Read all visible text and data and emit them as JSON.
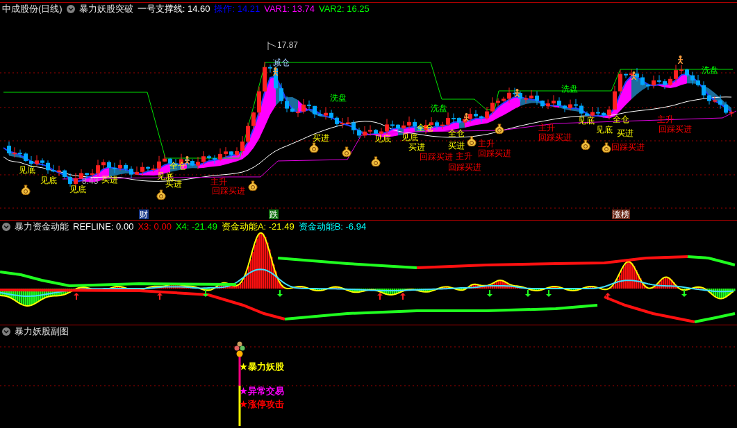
{
  "header": {
    "title": "中成股份(日线)",
    "indicator": "暴力妖股突破",
    "values": [
      {
        "text": "一号支撑线: 14.60",
        "color": "#ffffff"
      },
      {
        "text": "操作: 14.21",
        "color": "#0000ff"
      },
      {
        "text": "VAR1: 13.74",
        "color": "#ff00ff"
      },
      {
        "text": "VAR2: 16.25",
        "color": "#00ff00"
      }
    ]
  },
  "main_chart": {
    "price_labels": [
      {
        "kind": "high",
        "text": "17.87"
      },
      {
        "kind": "low",
        "text": "8.43"
      }
    ],
    "signals": [
      {
        "kind": "bottom",
        "text": "见底"
      },
      {
        "kind": "bottom",
        "text": "见底"
      },
      {
        "kind": "bottom",
        "text": "见底"
      },
      {
        "kind": "buy",
        "text": "买进"
      },
      {
        "kind": "bottom",
        "text": "见底"
      },
      {
        "kind": "full",
        "text": "全仓"
      },
      {
        "kind": "buy",
        "text": "买进"
      },
      {
        "kind": "surge",
        "text": "主升"
      },
      {
        "kind": "pullback",
        "text": "回踩买进"
      },
      {
        "kind": "reduce",
        "text": "减仓"
      },
      {
        "kind": "buy",
        "text": "买进"
      },
      {
        "kind": "wash",
        "text": "洗盘"
      },
      {
        "kind": "bottom",
        "text": "见底"
      },
      {
        "kind": "bottom",
        "text": "见底"
      },
      {
        "kind": "full",
        "text": "全仓"
      },
      {
        "kind": "buy",
        "text": "买进"
      },
      {
        "kind": "wash",
        "text": "洗盘"
      },
      {
        "kind": "pullback",
        "text": "回踩买进"
      },
      {
        "kind": "full",
        "text": "全仓"
      },
      {
        "kind": "buy",
        "text": "买进"
      },
      {
        "kind": "surge",
        "text": "主升"
      },
      {
        "kind": "pullback",
        "text": "回踩买进"
      },
      {
        "kind": "surge",
        "text": "主升"
      },
      {
        "kind": "pullback",
        "text": "回踩买进"
      },
      {
        "kind": "surge",
        "text": "主升"
      },
      {
        "kind": "pullback",
        "text": "回踩买进"
      },
      {
        "kind": "wash",
        "text": "洗盘"
      },
      {
        "kind": "bottom",
        "text": "见底"
      },
      {
        "kind": "bottom",
        "text": "见底"
      },
      {
        "kind": "full",
        "text": "全仓"
      },
      {
        "kind": "buy",
        "text": "买进"
      },
      {
        "kind": "pullback",
        "text": "回踩买进"
      },
      {
        "kind": "surge",
        "text": "主升"
      },
      {
        "kind": "pullback",
        "text": "回踩买进"
      },
      {
        "kind": "wash",
        "text": "洗盘"
      }
    ],
    "markers": [
      {
        "kind": "finance",
        "text": "财"
      },
      {
        "kind": "fall",
        "text": "跌"
      },
      {
        "kind": "rise",
        "text": "涨榜"
      }
    ]
  },
  "fund_panel": {
    "title": "暴力资金动能",
    "values": [
      {
        "text": "REFLINE: 0.00",
        "color": "#ffffff"
      },
      {
        "text": "X3: 0.00",
        "color": "#ff0000"
      },
      {
        "text": "X4: -21.49",
        "color": "#00ff00"
      },
      {
        "text": "资金动能A: -21.49",
        "color": "#ffff00"
      },
      {
        "text": "资金动能B: -6.94",
        "color": "#00ffff"
      }
    ]
  },
  "sub_panel": {
    "title": "暴力妖股副图",
    "signals": [
      {
        "text": "暴力妖股",
        "color": "#ffff00"
      },
      {
        "text": "异常交易",
        "color": "#ff00ff"
      },
      {
        "text": "涨停攻击",
        "color": "#ff0000"
      }
    ]
  }
}
